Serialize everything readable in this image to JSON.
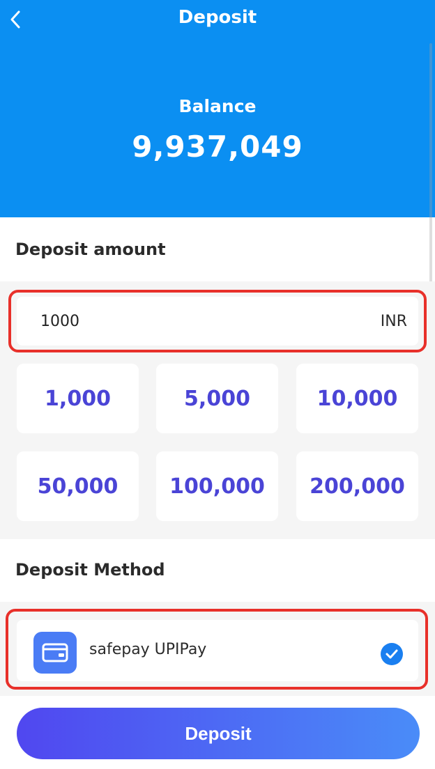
{
  "header": {
    "title": "Deposit",
    "balance_label": "Balance",
    "balance_value": "9,937,049"
  },
  "amount_section": {
    "title": "Deposit amount",
    "input_value": "1000",
    "currency": "INR",
    "presets": [
      "1,000",
      "5,000",
      "10,000",
      "50,000",
      "100,000",
      "200,000"
    ]
  },
  "method_section": {
    "title": "Deposit Method",
    "methods": [
      {
        "name": "safepay UPIPay",
        "icon": "wallet-icon",
        "selected": true
      }
    ]
  },
  "footer": {
    "deposit_label": "Deposit"
  },
  "colors": {
    "header_bg": "#0b8ff2",
    "preset_text": "#4a44d6",
    "highlight": "#e8302a",
    "check": "#1a7ff0"
  }
}
